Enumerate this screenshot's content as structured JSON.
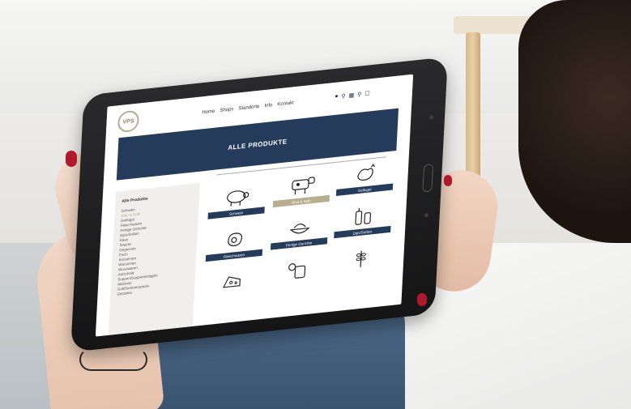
{
  "site": {
    "logo_text": "VPS",
    "nav": [
      "Home",
      "Shops",
      "Standorte",
      "Info",
      "Kontakt"
    ],
    "header_icons": [
      "user-icon",
      "search-icon",
      "calendar-icon",
      "location-pin-icon",
      "cart-icon"
    ],
    "banner_title": "ALLE PRODUKTE",
    "sidebar": {
      "title": "Alle Produkte",
      "items": [
        "Schwein",
        "Rind & Kalb",
        "Geflügel",
        "Fleischwaren",
        "Fertige Gerichte",
        "Dips/Soßen",
        "Käse",
        "Snacks",
        "Gegessen",
        "Fisch",
        "Konserven",
        "Würstchen",
        "Wurstwaren",
        "Aufschnitt",
        "Suppen/Suppeneinlagen",
        "Aktionen",
        "Grill/Sommerspezie",
        "Getränke"
      ]
    },
    "products": [
      {
        "label": "Schwein",
        "icon": "pig-icon",
        "highlight": false
      },
      {
        "label": "Rind & Kalb",
        "icon": "cow-icon",
        "highlight": true
      },
      {
        "label": "Geflügel",
        "icon": "rooster-icon",
        "highlight": false
      },
      {
        "label": "Fleischwaren",
        "icon": "meat-icon",
        "highlight": false
      },
      {
        "label": "Fertige Gerichte",
        "icon": "dish-icon",
        "highlight": false
      },
      {
        "label": "Dips/Soßen",
        "icon": "sauce-bottle-icon",
        "highlight": false
      },
      {
        "label": "",
        "icon": "cheese-icon",
        "highlight": false
      },
      {
        "label": "",
        "icon": "snacks-icon",
        "highlight": false
      },
      {
        "label": "",
        "icon": "grain-icon",
        "highlight": false
      }
    ]
  },
  "colors": {
    "brand_navy": "#243b5c",
    "brand_gold": "#b9ad8f",
    "nail_red": "#b0182b"
  }
}
